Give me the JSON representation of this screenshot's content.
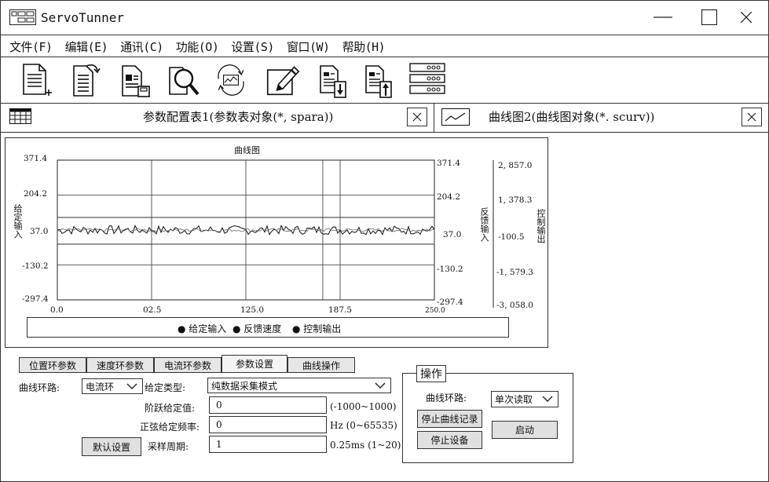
{
  "window": {
    "title": "ServoTunner"
  },
  "menu": [
    "文件(F)",
    "编辑(E)",
    "通讯(C)",
    "功能(O)",
    "设置(S)",
    "窗口(W)",
    "帮助(H)"
  ],
  "toolbar_icons": [
    "new-document-icon",
    "refresh-document-icon",
    "save-document-icon",
    "search-icon",
    "sync-chart-icon",
    "edit-icon",
    "download-icon",
    "upload-icon",
    "device-list-icon"
  ],
  "tabs": [
    {
      "label": "参数配置表1(参数表对象(*, spara))",
      "icon": "table-icon"
    },
    {
      "label": "曲线图2(曲线图对象(*. scurv))",
      "icon": "chart-icon"
    }
  ],
  "chart_data": {
    "type": "line",
    "title": "曲线图",
    "xlabel": "",
    "ylabel_left": "给定输入",
    "ylabel_right1": "反馈输入",
    "ylabel_right2": "控制输出",
    "x_ticks": [
      "0.0",
      "02.5",
      "125.0",
      "187.5",
      "250.0"
    ],
    "y_ticks_left": [
      "371.4",
      "204.2",
      "37.0",
      "-130.2",
      "-297.4"
    ],
    "y_ticks_right1": [
      "371.4",
      "204.2",
      "37.0",
      "-130.2",
      "-297.4"
    ],
    "y_ticks_right2": [
      "2, 857.0",
      "1, 378.3",
      "-100.5",
      "-1, 579.3",
      "-3, 058.0"
    ],
    "xlim": [
      0,
      250
    ],
    "ylim": [
      -297.4,
      371.4
    ],
    "legend": [
      "给定输入",
      "反馈速度",
      "控制输出"
    ],
    "legend_position": "bottom",
    "series": [
      {
        "name": "反馈速度",
        "color": "#111111",
        "amplitude": 18,
        "center": 37
      },
      {
        "name": "控制输出",
        "color": "#666666",
        "amplitude": 8,
        "center": 37
      }
    ]
  },
  "subtabs": [
    "位置环参数",
    "速度环参数",
    "电流环参数",
    "参数设置",
    "曲线操作"
  ],
  "form": {
    "loop_label": "曲线环路:",
    "loop_value": "电流环",
    "given_type_label": "给定类型:",
    "given_type_value": "纯数据采集模式",
    "step_label": "阶跃给定值:",
    "step_value": "0",
    "step_range": "(-1000~1000)",
    "sine_label": "正弦给定频率:",
    "sine_value": "0",
    "sine_range": "Hz (0~65535)",
    "sample_label": "采样周期:",
    "sample_value": "1",
    "sample_range": "0.25ms (1~20)",
    "default_button": "默认设置"
  },
  "operation": {
    "title": "操作",
    "loop_label": "曲线环路:",
    "read_mode": "单次读取",
    "stop_record": "停止曲线记录",
    "stop_device": "停止设备",
    "start": "启动"
  }
}
